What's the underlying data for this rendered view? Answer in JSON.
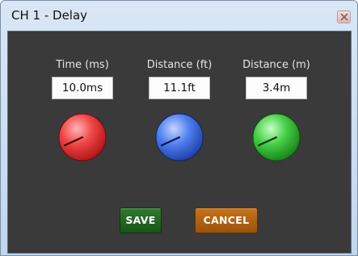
{
  "window": {
    "title": "CH 1 - Delay",
    "close_icon": "close-icon"
  },
  "controls": [
    {
      "label": "Time (ms)",
      "value": "10.0ms",
      "knob_color": "#e02a2a"
    },
    {
      "label": "Distance (ft)",
      "value": "11.1ft",
      "knob_color": "#2e5fd8"
    },
    {
      "label": "Distance (m)",
      "value": "3.4m",
      "knob_color": "#2fb52f"
    }
  ],
  "buttons": {
    "save_label": "SAVE",
    "cancel_label": "CANCEL",
    "save_color": "#236b23",
    "cancel_color": "#b5650f"
  },
  "colors": {
    "panel_background": "#3a3a3a",
    "label_text": "#e4e4e4"
  }
}
